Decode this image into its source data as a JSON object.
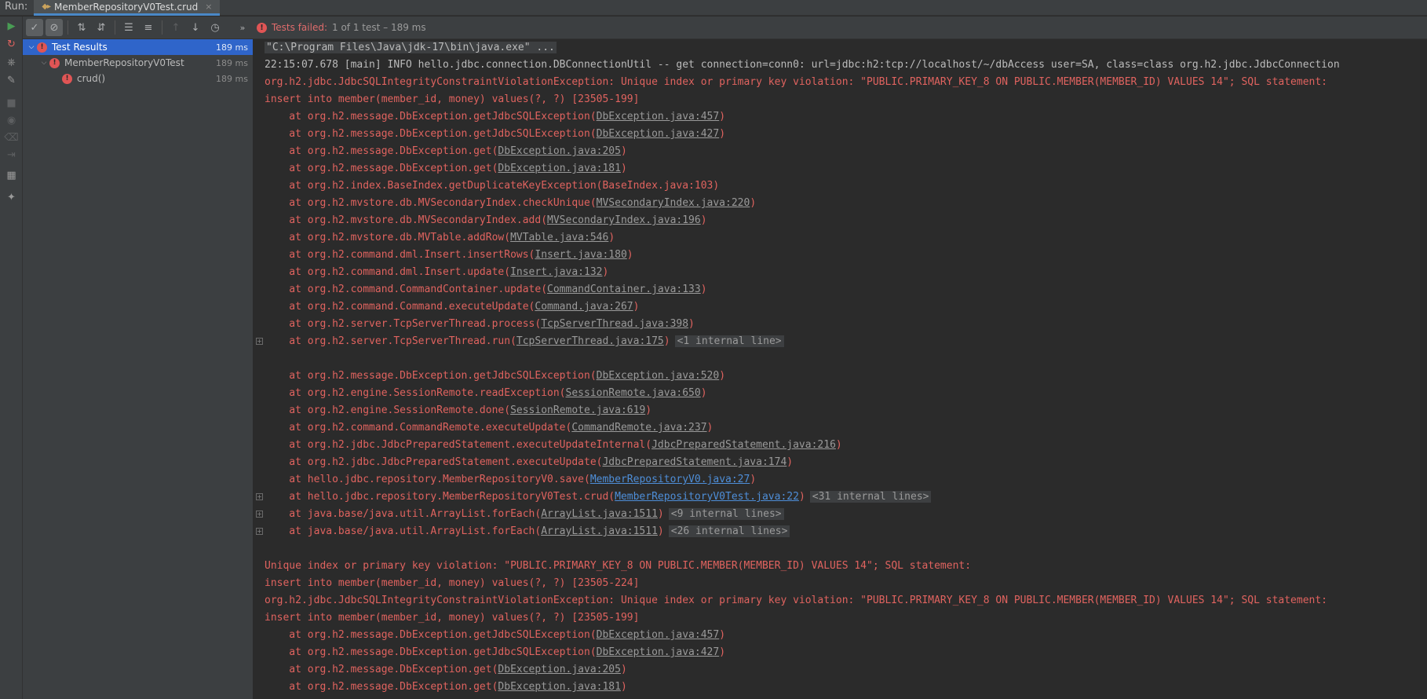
{
  "run_tab": {
    "label": "Run:",
    "tab_title": "MemberRepositoryV0Test.crud",
    "close": "×"
  },
  "status": {
    "failed_text": "Tests failed:",
    "rest_text": "1 of 1 test – 189 ms",
    "icon": "!"
  },
  "tree": [
    {
      "indent": 0,
      "chevron": "⌵",
      "name": "Test Results",
      "time": "189 ms",
      "selected": true
    },
    {
      "indent": 1,
      "chevron": "⌵",
      "name": "MemberRepositoryV0Test",
      "time": "189 ms",
      "selected": false
    },
    {
      "indent": 2,
      "chevron": "",
      "name": "crud()",
      "time": "189 ms",
      "selected": false
    }
  ],
  "console": [
    {
      "type": "cmd",
      "text": "\"C:\\Program Files\\Java\\jdk-17\\bin\\java.exe\" ..."
    },
    {
      "type": "info",
      "text": "22:15:07.678 [main] INFO hello.jdbc.connection.DBConnectionUtil -- get connection=conn0: url=jdbc:h2:tcp://localhost/~/dbAccess user=SA, class=class org.h2.jdbc.JdbcConnection"
    },
    {
      "type": "err",
      "text": "org.h2.jdbc.JdbcSQLIntegrityConstraintViolationException: Unique index or primary key violation: \"PUBLIC.PRIMARY_KEY_8 ON PUBLIC.MEMBER(MEMBER_ID) VALUES 14\"; SQL statement:"
    },
    {
      "type": "err",
      "text": "insert into member(member_id, money) values(?, ?) [23505-199]"
    },
    {
      "type": "frame",
      "pre": "    at org.h2.message.DbException.getJdbcSQLException(",
      "link": "DbException.java:457",
      "post": ")"
    },
    {
      "type": "frame",
      "pre": "    at org.h2.message.DbException.getJdbcSQLException(",
      "link": "DbException.java:427",
      "post": ")"
    },
    {
      "type": "frame",
      "pre": "    at org.h2.message.DbException.get(",
      "link": "DbException.java:205",
      "post": ")"
    },
    {
      "type": "frame",
      "pre": "    at org.h2.message.DbException.get(",
      "link": "DbException.java:181",
      "post": ")"
    },
    {
      "type": "frame",
      "pre": "    at org.h2.index.BaseIndex.getDuplicateKeyException(BaseIndex.java:103)",
      "link": "",
      "post": ""
    },
    {
      "type": "frame",
      "pre": "    at org.h2.mvstore.db.MVSecondaryIndex.checkUnique(",
      "link": "MVSecondaryIndex.java:220",
      "post": ")"
    },
    {
      "type": "frame",
      "pre": "    at org.h2.mvstore.db.MVSecondaryIndex.add(",
      "link": "MVSecondaryIndex.java:196",
      "post": ")"
    },
    {
      "type": "frame",
      "pre": "    at org.h2.mvstore.db.MVTable.addRow(",
      "link": "MVTable.java:546",
      "post": ")"
    },
    {
      "type": "frame",
      "pre": "    at org.h2.command.dml.Insert.insertRows(",
      "link": "Insert.java:180",
      "post": ")"
    },
    {
      "type": "frame",
      "pre": "    at org.h2.command.dml.Insert.update(",
      "link": "Insert.java:132",
      "post": ")"
    },
    {
      "type": "frame",
      "pre": "    at org.h2.command.CommandContainer.update(",
      "link": "CommandContainer.java:133",
      "post": ")"
    },
    {
      "type": "frame",
      "pre": "    at org.h2.command.Command.executeUpdate(",
      "link": "Command.java:267",
      "post": ")"
    },
    {
      "type": "frame",
      "pre": "    at org.h2.server.TcpServerThread.process(",
      "link": "TcpServerThread.java:398",
      "post": ")"
    },
    {
      "type": "frame",
      "fold": true,
      "pre": "    at org.h2.server.TcpServerThread.run(",
      "link": "TcpServerThread.java:175",
      "post": ")",
      "internal": "<1 internal line>"
    },
    {
      "type": "blank"
    },
    {
      "type": "frame",
      "pre": "    at org.h2.message.DbException.getJdbcSQLException(",
      "link": "DbException.java:520",
      "post": ")"
    },
    {
      "type": "frame",
      "pre": "    at org.h2.engine.SessionRemote.readException(",
      "link": "SessionRemote.java:650",
      "post": ")"
    },
    {
      "type": "frame",
      "pre": "    at org.h2.engine.SessionRemote.done(",
      "link": "SessionRemote.java:619",
      "post": ")"
    },
    {
      "type": "frame",
      "pre": "    at org.h2.command.CommandRemote.executeUpdate(",
      "link": "CommandRemote.java:237",
      "post": ")"
    },
    {
      "type": "frame",
      "pre": "    at org.h2.jdbc.JdbcPreparedStatement.executeUpdateInternal(",
      "link": "JdbcPreparedStatement.java:216",
      "post": ")"
    },
    {
      "type": "frame",
      "pre": "    at org.h2.jdbc.JdbcPreparedStatement.executeUpdate(",
      "link": "JdbcPreparedStatement.java:174",
      "post": ")"
    },
    {
      "type": "frame",
      "pre": "    at hello.jdbc.repository.MemberRepositoryV0.save(",
      "link": "MemberRepositoryV0.java:27",
      "post": ")",
      "project": true
    },
    {
      "type": "frame",
      "fold": true,
      "pre": "    at hello.jdbc.repository.MemberRepositoryV0Test.crud(",
      "link": "MemberRepositoryV0Test.java:22",
      "post": ")",
      "project": true,
      "internal": "<31 internal lines>"
    },
    {
      "type": "frame",
      "fold": true,
      "pre": "    at java.base/java.util.ArrayList.forEach(",
      "link": "ArrayList.java:1511",
      "post": ")",
      "internal": "<9 internal lines>"
    },
    {
      "type": "frame",
      "fold": true,
      "pre": "    at java.base/java.util.ArrayList.forEach(",
      "link": "ArrayList.java:1511",
      "post": ")",
      "internal": "<26 internal lines>"
    },
    {
      "type": "blank"
    },
    {
      "type": "err",
      "text": "Unique index or primary key violation: \"PUBLIC.PRIMARY_KEY_8 ON PUBLIC.MEMBER(MEMBER_ID) VALUES 14\"; SQL statement:"
    },
    {
      "type": "err",
      "text": "insert into member(member_id, money) values(?, ?) [23505-224]"
    },
    {
      "type": "err",
      "text": "org.h2.jdbc.JdbcSQLIntegrityConstraintViolationException: Unique index or primary key violation: \"PUBLIC.PRIMARY_KEY_8 ON PUBLIC.MEMBER(MEMBER_ID) VALUES 14\"; SQL statement:"
    },
    {
      "type": "err",
      "text": "insert into member(member_id, money) values(?, ?) [23505-199]"
    },
    {
      "type": "frame",
      "pre": "    at org.h2.message.DbException.getJdbcSQLException(",
      "link": "DbException.java:457",
      "post": ")"
    },
    {
      "type": "frame",
      "pre": "    at org.h2.message.DbException.getJdbcSQLException(",
      "link": "DbException.java:427",
      "post": ")"
    },
    {
      "type": "frame",
      "pre": "    at org.h2.message.DbException.get(",
      "link": "DbException.java:205",
      "post": ")"
    },
    {
      "type": "frame",
      "pre": "    at org.h2.message.DbException.get(",
      "link": "DbException.java:181",
      "post": ")"
    }
  ],
  "colors": {
    "accent": "#4a88c7",
    "selection": "#2f65ca",
    "error": "#e0635f",
    "run_green": "#499c54"
  }
}
